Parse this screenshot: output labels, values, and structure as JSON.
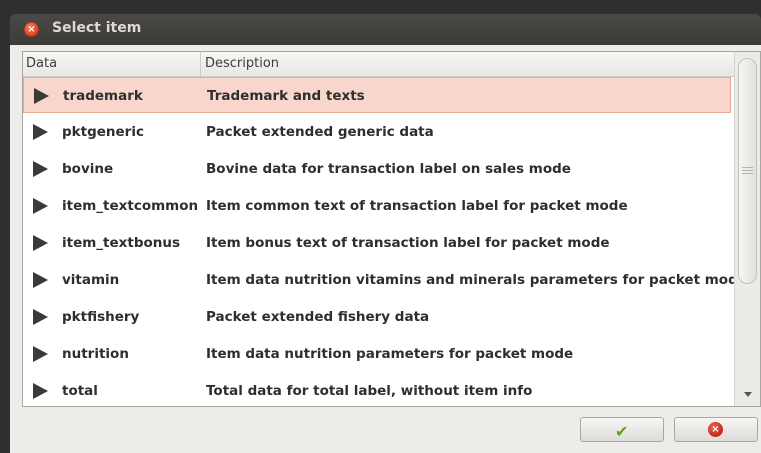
{
  "window": {
    "title": "Select item",
    "close_glyph": "×"
  },
  "list": {
    "columns": {
      "data": "Data",
      "description": "Description"
    },
    "rows": [
      {
        "name": "trademark",
        "description": "Trademark and texts",
        "selected": true
      },
      {
        "name": "pktgeneric",
        "description": "Packet extended generic data",
        "selected": false
      },
      {
        "name": "bovine",
        "description": "Bovine data for transaction label on sales mode",
        "selected": false
      },
      {
        "name": "item_textcommon",
        "description": "Item common text of transaction label for packet mode",
        "selected": false
      },
      {
        "name": "item_textbonus",
        "description": "Item bonus text of transaction label for packet mode",
        "selected": false
      },
      {
        "name": "vitamin",
        "description": "Item data nutrition vitamins and minerals parameters for packet mode",
        "selected": false
      },
      {
        "name": "pktfishery",
        "description": "Packet extended fishery data",
        "selected": false
      },
      {
        "name": "nutrition",
        "description": "Item data nutrition parameters for packet mode",
        "selected": false
      },
      {
        "name": "total",
        "description": "Total data for total label, without item info",
        "selected": false
      }
    ]
  },
  "buttons": {
    "ok_icon": "check-icon",
    "ok_glyph": "✔",
    "cancel_icon": "cancel-icon",
    "cancel_glyph": "×"
  },
  "colors": {
    "selection": "#f9d6cb",
    "ok_green": "#5fa51a",
    "cancel_red": "#c62318"
  }
}
